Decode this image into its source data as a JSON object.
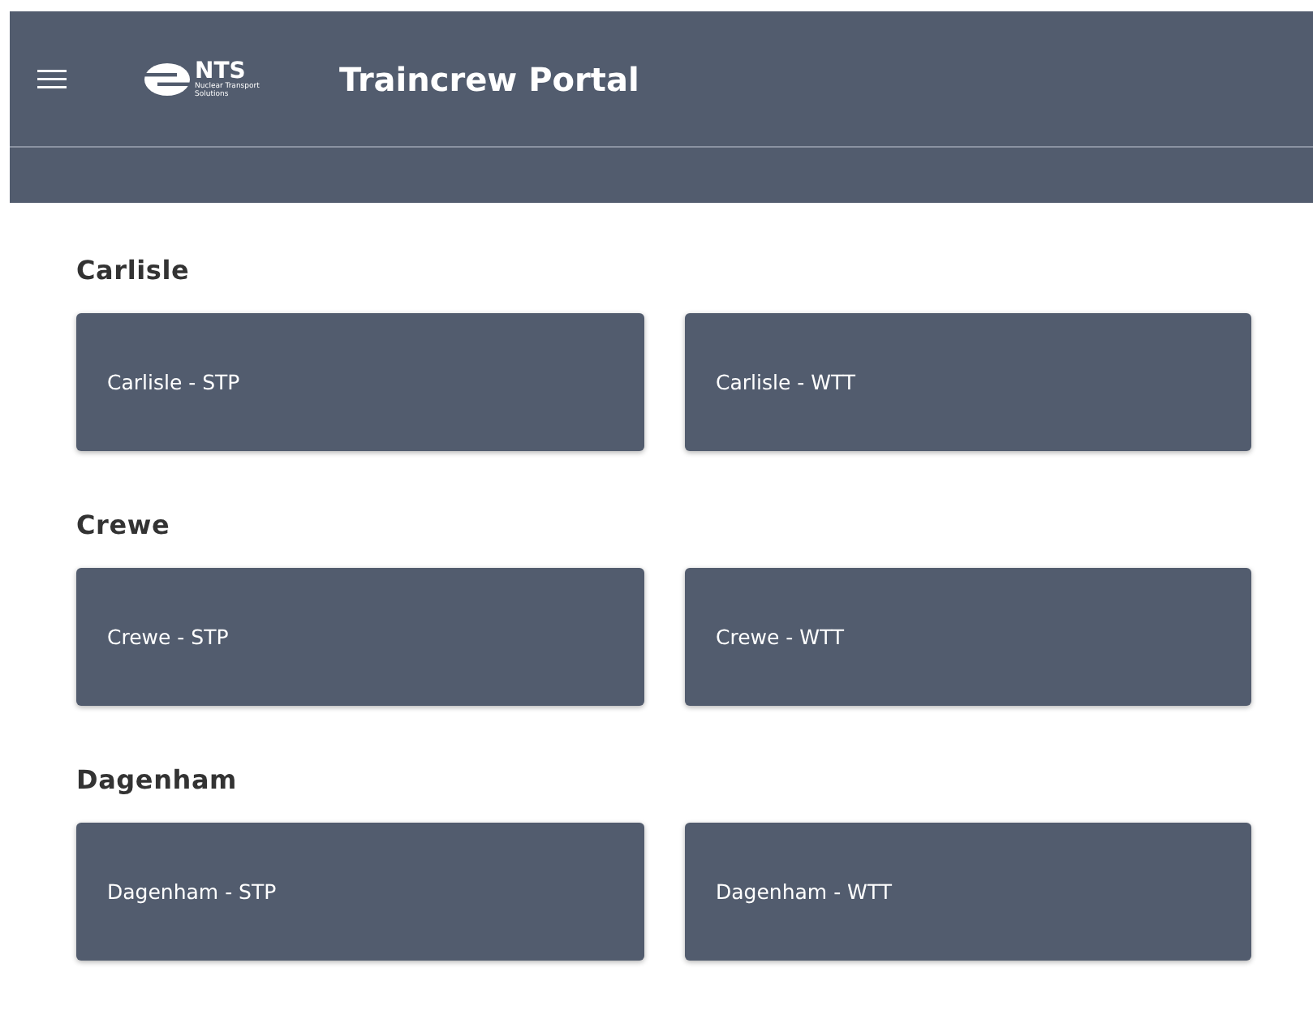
{
  "header": {
    "logo": {
      "name": "NTS",
      "tagline_1": "Nuclear Transport",
      "tagline_2": "Solutions"
    },
    "title": "Traincrew Portal"
  },
  "sections": [
    {
      "heading": "Carlisle",
      "cards": [
        "Carlisle - STP",
        "Carlisle - WTT"
      ]
    },
    {
      "heading": "Crewe",
      "cards": [
        "Crewe - STP",
        "Crewe - WTT"
      ]
    },
    {
      "heading": "Dagenham",
      "cards": [
        "Dagenham - STP",
        "Dagenham - WTT"
      ]
    }
  ]
}
